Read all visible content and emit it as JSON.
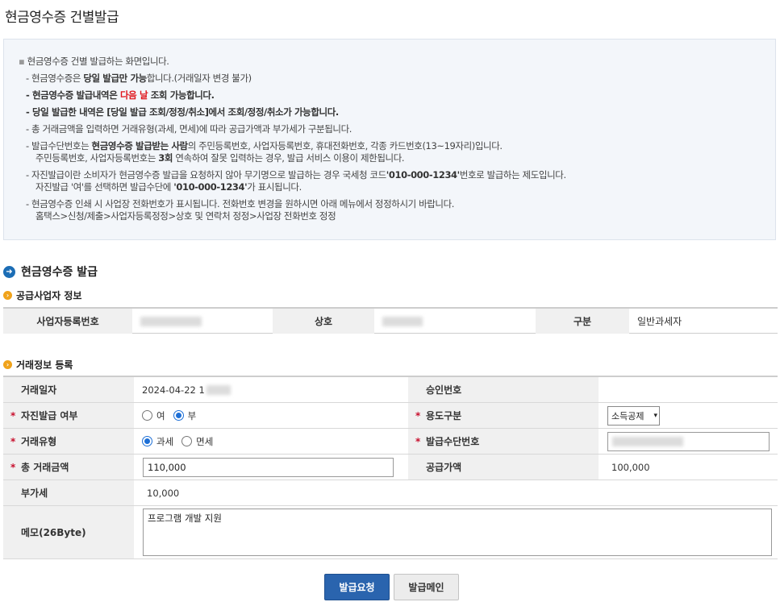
{
  "page": {
    "title": "현금영수증 건별발급"
  },
  "notice": {
    "intro": "현금영수증 건별 발급하는 화면입니다.",
    "l1": {
      "pre": "- 현금영수증은 ",
      "b": "당일 발급만 가능",
      "post": "합니다.(거래일자 변경 불가)"
    },
    "l2": {
      "pre": "- 현금영수증 발급내역은 ",
      "red": "다음 날",
      "post": " 조회 가능합니다."
    },
    "l3": "- 당일 발급한 내역은 [당일 발급 조회/정정/취소]에서 조회/정정/취소가 가능합니다.",
    "l4": "- 총 거래금액을 입력하면 거래유형(과세, 면세)에 따라 공급가액과 부가세가 구분됩니다.",
    "l5": {
      "pre": "- 발급수단번호는 ",
      "b": "현금영수증 발급받는 사람",
      "post": "의  주민등록번호, 사업자등록번호, 휴대전화번호, 각종 카드번호(13~19자리)입니다."
    },
    "l6": {
      "pre": "주민등록번호, 사업자등록번호는 ",
      "b": "3회",
      "post": " 연속하여 잘못 입력하는 경우, 발급 서비스 이용이 제한됩니다."
    },
    "l7": {
      "pre": "- 자진발급이란 소비자가 현금영수증 발급을 요청하지 않아 무기명으로 발급하는 경우 국세청 코드",
      "b": "'010-000-1234'",
      "post": "번호로 발급하는 제도입니다."
    },
    "l8": {
      "pre": "자진발급 '여'를 선택하면 발급수단에 ",
      "b": "'010-000-1234'",
      "post": "가 표시됩니다."
    },
    "l9": "- 현금영수증 인쇄 시 사업장 전화번호가 표시됩니다. 전화번호 변경을 원하시면 아래 메뉴에서 정정하시기 바랍니다.",
    "l10": "홈택스>신청/제출>사업자등록정정>상호 및 연락처 정정>사업장 전화번호 정정"
  },
  "section": {
    "title": "현금영수증 발급"
  },
  "supplier": {
    "title": "공급사업자 정보",
    "biz_no_label": "사업자등록번호",
    "name_label": "상호",
    "type_label": "구분",
    "type_value": "일반과세자"
  },
  "trade": {
    "title": "거래정보 등록",
    "date_label": "거래일자",
    "date_value": "2024-04-22 1",
    "approval_label": "승인번호",
    "self_issue_label": "자진발급 여부",
    "self_yes": "여",
    "self_no": "부",
    "usage_label": "용도구분",
    "usage_value": "소득공제",
    "type_label": "거래유형",
    "type_taxable": "과세",
    "type_exempt": "면세",
    "means_label": "발급수단번호",
    "total_label": "총 거래금액",
    "total_value": "110,000",
    "supply_label": "공급가액",
    "supply_value": "100,000",
    "vat_label": "부가세",
    "vat_value": "10,000",
    "memo_label": "메모(26Byte)",
    "memo_value": "프로그램 개발 지원"
  },
  "buttons": {
    "request": "발급요청",
    "main": "발급메인"
  },
  "colors": {
    "accent": "#2a64ae",
    "required": "#c8102e",
    "highlight": "#e0141b"
  }
}
